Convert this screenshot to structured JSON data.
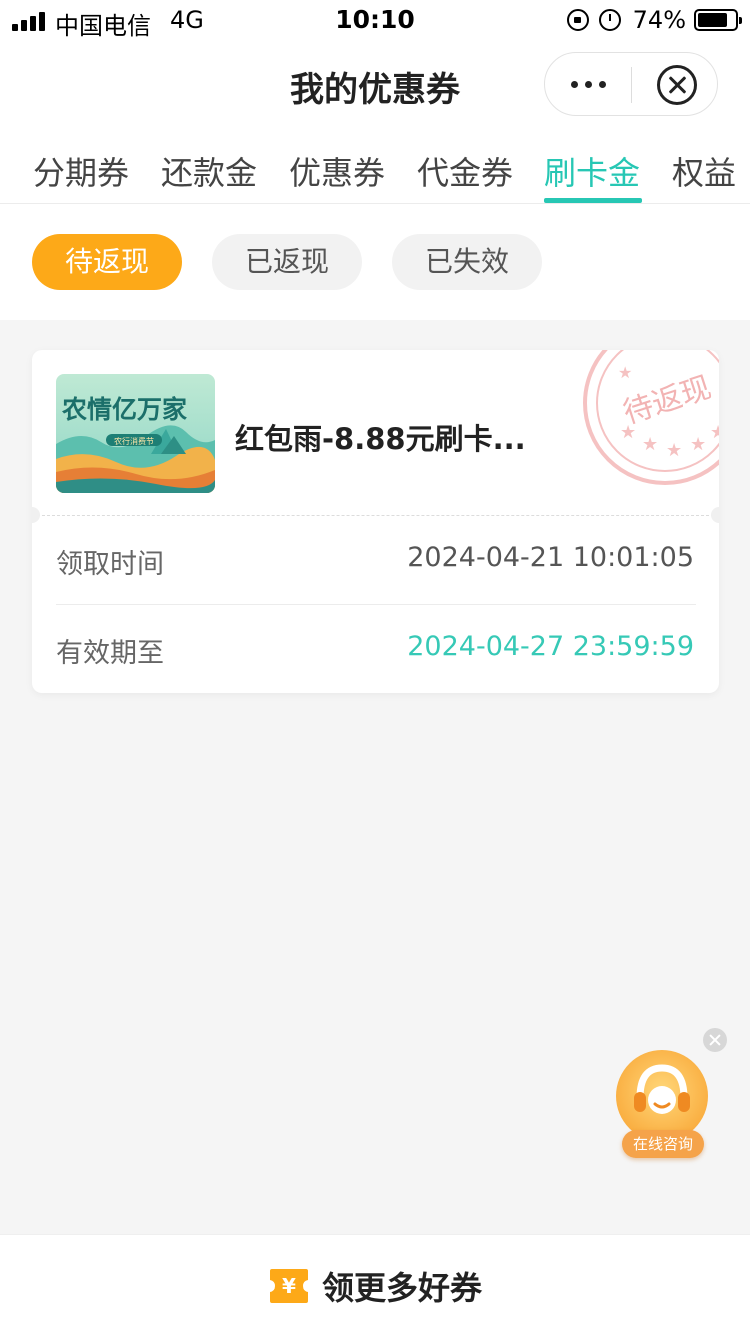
{
  "status_bar": {
    "carrier": "中国电信",
    "network": "4G",
    "time": "10:10",
    "battery": "74%"
  },
  "nav": {
    "title": "我的优惠券"
  },
  "tabs": [
    {
      "label": "分期券",
      "active": false
    },
    {
      "label": "还款金",
      "active": false
    },
    {
      "label": "优惠券",
      "active": false
    },
    {
      "label": "代金券",
      "active": false
    },
    {
      "label": "刷卡金",
      "active": true
    },
    {
      "label": "权益",
      "active": false
    }
  ],
  "filters": [
    {
      "label": "待返现",
      "active": true
    },
    {
      "label": "已返现",
      "active": false
    },
    {
      "label": "已失效",
      "active": false
    }
  ],
  "coupon": {
    "image_text": "农情亿万家",
    "image_subtext": "农行消费节",
    "title": "红包雨-8.88元刷卡...",
    "stamp_text": "待返现",
    "received_label": "领取时间",
    "received_value": "2024-04-21 10:01:05",
    "expiry_label": "有效期至",
    "expiry_value": "2024-04-27 23:59:59"
  },
  "consult": {
    "label": "在线咨询"
  },
  "bottom": {
    "icon_symbol": "¥",
    "label": "领更多好券"
  },
  "colors": {
    "accent_teal": "#27c7b4",
    "chip_active": "#fda918",
    "stamp_red": "#f08a8a"
  }
}
